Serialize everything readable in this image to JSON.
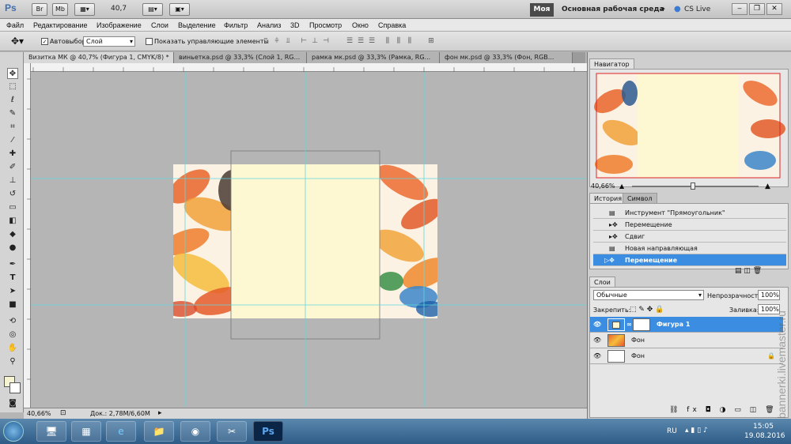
{
  "appbar": {
    "logo": "Ps",
    "btn_br": "Br",
    "btn_mb": "Mb",
    "zoom": "40,7",
    "workspace_btn": "Моя",
    "workspace_name": "Основная рабочая среда",
    "cs_live": "CS Live"
  },
  "menu": [
    "Файл",
    "Редактирование",
    "Изображение",
    "Слои",
    "Выделение",
    "Фильтр",
    "Анализ",
    "3D",
    "Просмотр",
    "Окно",
    "Справка"
  ],
  "options": {
    "auto_select_label": "Автовыбор:",
    "auto_select_value": "Слой",
    "show_controls_label": "Показать управляющие элементы"
  },
  "tabs": [
    "Визитка МК @ 40,7% (Фигура 1, CMYK/8) *",
    "виньетка.psd @ 33,3% (Слой 1, RG...",
    "рамка мк.psd @ 33,3% (Рамка, RG...",
    "фон мк.psd @ 33,3% (Фон, RGB..."
  ],
  "status": {
    "zoom": "40,66%",
    "doc": "Док.: 2,78M/6,60M"
  },
  "navigator": {
    "title": "Навигатор",
    "zoom": "40,66%"
  },
  "history": {
    "tab1": "История",
    "tab2": "Символ",
    "items": [
      "Инструмент \"Прямоугольник\"",
      "Перемещение",
      "Сдвиг",
      "Новая направляющая",
      "Перемещение"
    ]
  },
  "layers": {
    "title": "Слои",
    "blend": "Обычные",
    "opacity_label": "Непрозрачность:",
    "opacity": "100%",
    "lock_label": "Закрепить:",
    "fill_label": "Заливка:",
    "fill": "100%",
    "items": [
      "Фигура 1",
      "Фон",
      "Фон"
    ]
  },
  "taskbar": {
    "lang": "RU",
    "time": "15:05",
    "date": "19.08.2016"
  },
  "watermark": "bannerki.livemaster.ru",
  "colors": {
    "selection_blue": "#3a8de0",
    "canvas_cream": "#fdf7d2",
    "guide_cyan": "#5fd8e0"
  }
}
